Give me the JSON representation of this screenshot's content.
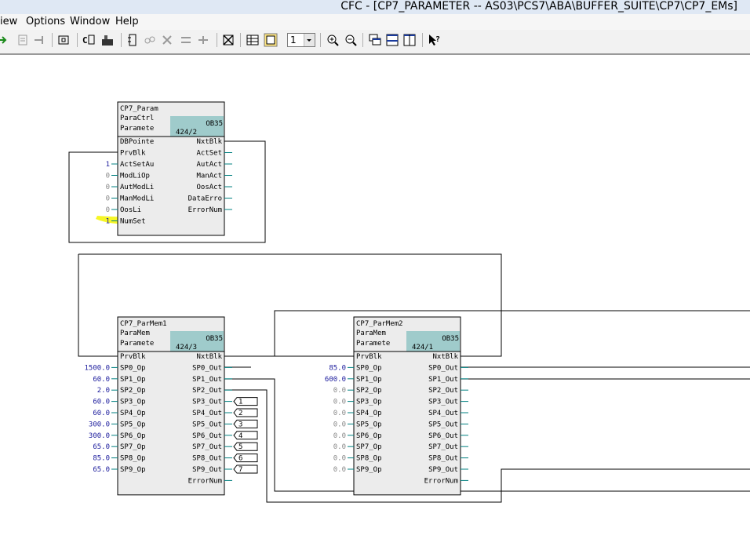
{
  "window": {
    "title": "CFC - [CP7_PARAMETER -- AS03\\PCS7\\ABA\\BUFFER_SUITE\\CP7\\CP7_EMs]"
  },
  "menu": [
    "iew",
    "Options",
    "Window",
    "Help"
  ],
  "toolbar": {
    "zoom_value": "1",
    "icons": [
      "run-icon",
      "block-print-icon",
      "connect-icon",
      "new-sheet-icon",
      "compile-icon",
      "chart-icon",
      "insert-block-icon",
      "interconnect-icon",
      "delete-icon",
      "split-icon",
      "join-icon",
      "overview-icon",
      "table-view-icon",
      "sheet-view-icon",
      "zoom-in-icon",
      "zoom-out-icon",
      "cascade-icon",
      "tile-horizontal-icon",
      "tile-vertical-icon",
      "help-icon"
    ]
  },
  "colors": {
    "block_fill": "#ececec",
    "task_fill": "#9fcbcb",
    "value_blue": "#1a1a9c",
    "value_gray": "#888888",
    "highlight": "#f4f500",
    "wire": "#000000",
    "stub": "#008080"
  },
  "blocks": [
    {
      "id": "param",
      "name": "CP7_Param",
      "type": "ParaCtrl",
      "comment": "Paramete",
      "task": "OB35",
      "seq": "424/2",
      "inputs": [
        "DBPointe",
        "PrvBlk",
        "ActSetAu",
        "ModLiOp",
        "AutModLi",
        "ManModLi",
        "OosLi",
        "NumSet"
      ],
      "input_values": [
        "",
        "",
        "1",
        "0",
        "0",
        "0",
        "0",
        "1"
      ],
      "outputs": [
        "NxtBlk",
        "ActSet",
        "AutAct",
        "ManAct",
        "OosAct",
        "DataErro",
        "ErrorNum"
      ]
    },
    {
      "id": "mem1",
      "name": "CP7_ParMem1",
      "type": "ParaMem",
      "comment": "Paramete",
      "task": "OB35",
      "seq": "424/3",
      "inputs": [
        "PrvBlk",
        "SP0_Op",
        "SP1_Op",
        "SP2_Op",
        "SP3_Op",
        "SP4_Op",
        "SP5_Op",
        "SP6_Op",
        "SP7_Op",
        "SP8_Op",
        "SP9_Op"
      ],
      "input_values": [
        "",
        "1500.0",
        "60.0",
        "2.0",
        "60.0",
        "60.0",
        "300.0",
        "300.0",
        "65.0",
        "85.0",
        "65.0"
      ],
      "outputs": [
        "NxtBlk",
        "SP0_Out",
        "SP1_Out",
        "SP2_Out",
        "SP3_Out",
        "SP4_Out",
        "SP5_Out",
        "SP6_Out",
        "SP7_Out",
        "SP8_Out",
        "SP9_Out",
        "ErrorNum"
      ],
      "output_refs": [
        "",
        "",
        "",
        "",
        "1",
        "2",
        "3",
        "4",
        "5",
        "6",
        "7",
        ""
      ]
    },
    {
      "id": "mem2",
      "name": "CP7_ParMem2",
      "type": "ParaMem",
      "comment": "Paramete",
      "task": "OB35",
      "seq": "424/1",
      "inputs": [
        "PrvBlk",
        "SP0_Op",
        "SP1_Op",
        "SP2_Op",
        "SP3_Op",
        "SP4_Op",
        "SP5_Op",
        "SP6_Op",
        "SP7_Op",
        "SP8_Op",
        "SP9_Op"
      ],
      "input_values": [
        "",
        "85.0",
        "600.0",
        "0.0",
        "0.0",
        "0.0",
        "0.0",
        "0.0",
        "0.0",
        "0.0",
        "0.0"
      ],
      "outputs": [
        "NxtBlk",
        "SP0_Out",
        "SP1_Out",
        "SP2_Out",
        "SP3_Out",
        "SP4_Out",
        "SP5_Out",
        "SP6_Out",
        "SP7_Out",
        "SP8_Out",
        "SP9_Out",
        "ErrorNum"
      ],
      "output_refs": [
        "",
        "",
        "",
        "",
        "",
        "",
        "",
        "",
        "",
        "",
        "",
        ""
      ]
    }
  ]
}
